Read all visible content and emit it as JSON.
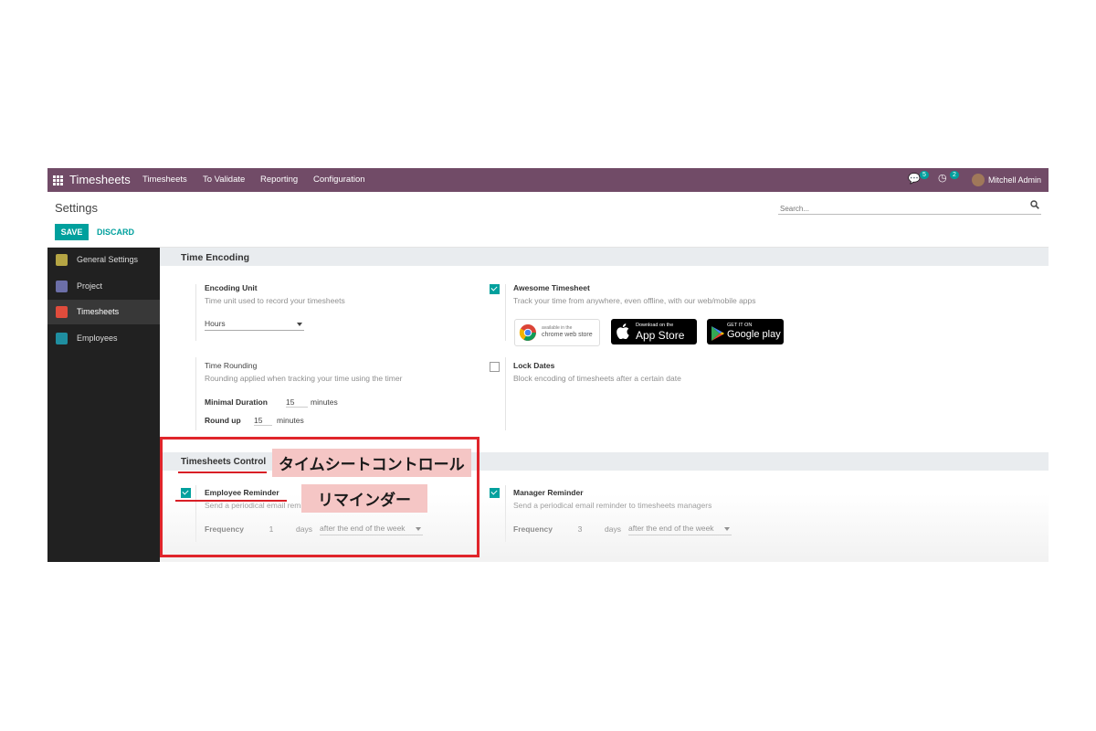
{
  "navbar": {
    "app_name": "Timesheets",
    "menu": [
      "Timesheets",
      "To Validate",
      "Reporting",
      "Configuration"
    ],
    "messages_count": "5",
    "activities_count": "2",
    "user_name": "Mitchell Admin"
  },
  "control_panel": {
    "breadcrumb": "Settings",
    "save_label": "SAVE",
    "discard_label": "DISCARD",
    "search_placeholder": "Search..."
  },
  "sidebar": {
    "items": [
      {
        "label": "General Settings",
        "icon": "gear-icon",
        "color": "#b5a544"
      },
      {
        "label": "Project",
        "icon": "puzzle-icon",
        "color": "#6c6fa8"
      },
      {
        "label": "Timesheets",
        "icon": "stopwatch-icon",
        "color": "#e04c3c"
      },
      {
        "label": "Employees",
        "icon": "people-icon",
        "color": "#1f8ea0"
      }
    ],
    "active": "Timesheets"
  },
  "time_encoding": {
    "title": "Time Encoding",
    "encoding_unit": {
      "label": "Encoding Unit",
      "description": "Time unit used to record your timesheets",
      "value": "Hours"
    },
    "awesome_timesheet": {
      "label": "Awesome Timesheet",
      "description": "Track your time from anywhere, even offline, with our web/mobile apps",
      "checked": true,
      "stores": {
        "chrome_line1": "available in the",
        "chrome_line2": "chrome web store",
        "apple_line1": "Download on the",
        "apple_line2": "App Store",
        "google_line1": "GET IT ON",
        "google_line2": "Google play"
      }
    },
    "time_rounding": {
      "label": "Time Rounding",
      "description": "Rounding applied when tracking your time using the timer",
      "minimal_label": "Minimal Duration",
      "minimal_value": "15",
      "minimal_unit": "minutes",
      "roundup_label": "Round up",
      "roundup_value": "15",
      "roundup_unit": "minutes"
    },
    "lock_dates": {
      "label": "Lock Dates",
      "description": "Block encoding of timesheets after a certain date",
      "checked": false
    }
  },
  "timesheets_control": {
    "title": "Timesheets Control",
    "employee_reminder": {
      "label": "Employee Reminder",
      "description": "Send a periodical email reminder to timesheets",
      "checked": true,
      "frequency_label": "Frequency",
      "frequency_value": "1",
      "unit": "days",
      "when": "after the end of the week"
    },
    "manager_reminder": {
      "label": "Manager Reminder",
      "description": "Send a periodical email reminder to timesheets managers",
      "checked": true,
      "frequency_label": "Frequency",
      "frequency_value": "3",
      "unit": "days",
      "when": "after the end of the week"
    }
  },
  "annotations": {
    "control_jp": "タイムシートコントロール",
    "reminder_jp": "リマインダー",
    "highlight_color": "#e0252b"
  }
}
